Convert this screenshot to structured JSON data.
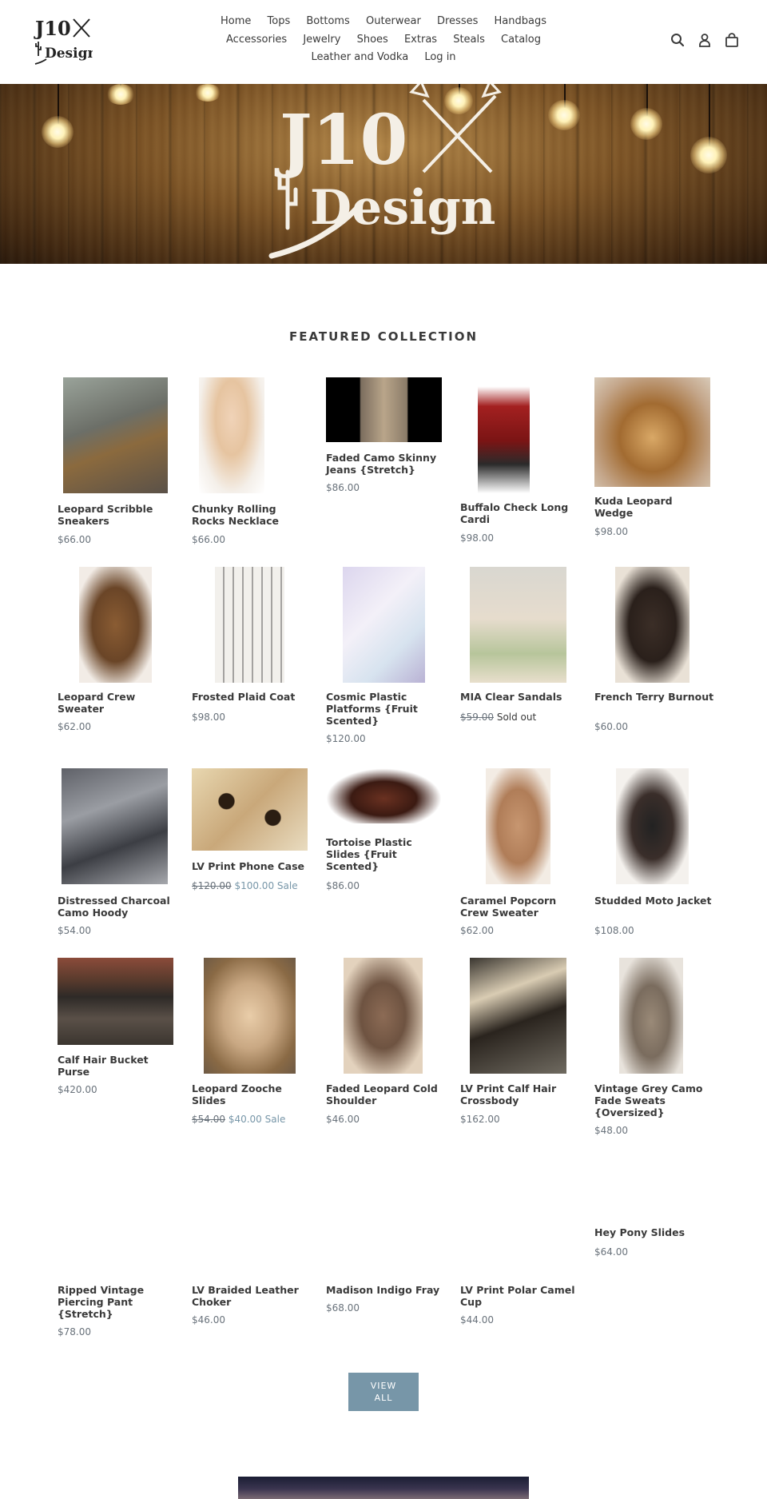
{
  "header": {
    "logo_text": "J10X Design",
    "nav": [
      "Home",
      "Tops",
      "Bottoms",
      "Outerwear",
      "Dresses",
      "Handbags",
      "Accessories",
      "Jewelry",
      "Shoes",
      "Extras",
      "Steals",
      "Catalog",
      "Leather and Vodka",
      "Log in"
    ],
    "icons": [
      "search-icon",
      "account-icon",
      "cart-icon"
    ]
  },
  "hero": {
    "logo_text": "J10X Design"
  },
  "featured": {
    "title": "FEATURED COLLECTION",
    "products": [
      {
        "title": "Leopard Scribble Sneakers",
        "price": "$66.00",
        "image": "leopard sneakers"
      },
      {
        "title": "Chunky Rolling Rocks Necklace",
        "price": "$66.00",
        "image": "model with necklace"
      },
      {
        "title": "Faded Camo Skinny Jeans {Stretch}",
        "price": "$86.00",
        "image": "camo jeans"
      },
      {
        "title": "Buffalo Check Long Cardi",
        "price": "$98.00",
        "image": "red plaid cardi"
      },
      {
        "title": "Kuda Leopard Wedge",
        "price": "$98.00",
        "image": "leopard wedge"
      },
      {
        "title": "Leopard Crew Sweater",
        "price": "$62.00",
        "image": "leopard sweater"
      },
      {
        "title": "Frosted Plaid Coat",
        "price": "$98.00",
        "image": "plaid coat"
      },
      {
        "title": "Cosmic Plastic Platforms {Fruit Scented}",
        "price": "$120.00",
        "image": "holographic sandals"
      },
      {
        "title": "MIA Clear Sandals",
        "price_old": "$59.00",
        "price_note": "Sold out",
        "image": "clear sandals"
      },
      {
        "title": "French Terry Burnout",
        "price": "$60.00",
        "image": "brown top"
      },
      {
        "title": "Distressed Charcoal Camo Hoody",
        "price": "$54.00",
        "image": "camo hoody"
      },
      {
        "title": "LV Print Phone Case",
        "price_old": "$120.00",
        "price_new": "$100.00",
        "price_note": "Sale",
        "image": "leopard phone case"
      },
      {
        "title": "Tortoise Plastic Slides {Fruit Scented}",
        "price": "$86.00",
        "image": "tortoise slides"
      },
      {
        "title": "Caramel Popcorn Crew Sweater",
        "price": "$62.00",
        "image": "caramel sweater"
      },
      {
        "title": "Studded Moto Jacket",
        "price": "$108.00",
        "image": "moto jacket"
      },
      {
        "title": "Calf Hair Bucket Purse",
        "price": "$420.00",
        "image": "bucket purse"
      },
      {
        "title": "Leopard Zooche Slides",
        "price_old": "$54.00",
        "price_new": "$40.00",
        "price_note": "Sale",
        "image": "leopard slides"
      },
      {
        "title": "Faded Leopard Cold Shoulder",
        "price": "$46.00",
        "image": "leopard top"
      },
      {
        "title": "LV Print Calf Hair Crossbody",
        "price": "$162.00",
        "image": "leopard crossbody"
      },
      {
        "title": "Vintage Grey Camo Fade Sweats {Oversized}",
        "price": "$48.00",
        "image": "camo sweats"
      },
      {
        "title": "Ripped Vintage Piercing Pant {Stretch}",
        "price": "$78.00"
      },
      {
        "title": "LV Braided Leather Choker",
        "price": "$46.00"
      },
      {
        "title": "Madison Indigo Fray",
        "price": "$68.00"
      },
      {
        "title": "LV Print Polar Camel Cup",
        "price": "$44.00"
      },
      {
        "title": "Hey Pony Slides",
        "price": "$64.00"
      }
    ],
    "view_all": "VIEW ALL"
  },
  "colors": {
    "accent": "#7796a8",
    "text": "#3a3a3a",
    "price": "#69727b"
  }
}
